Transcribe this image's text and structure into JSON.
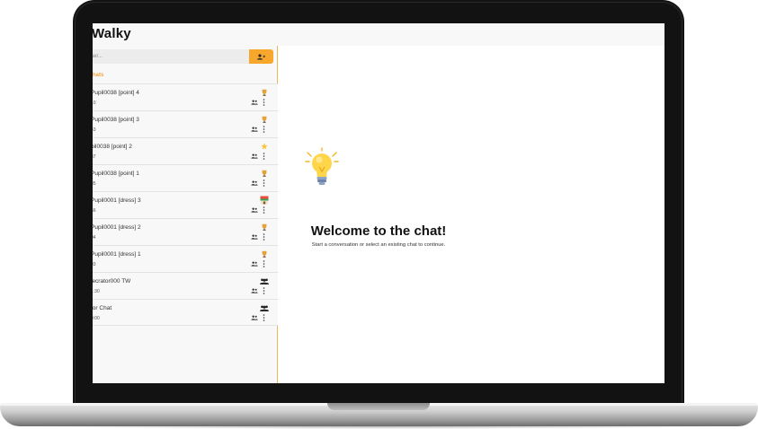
{
  "app": {
    "title": "Walky"
  },
  "search": {
    "placeholder": "ser..."
  },
  "sidebar": {
    "section_label": "hats",
    "chats": [
      {
        "name": "Pupil0038 [point] 4",
        "time": "10",
        "avatar": "trophy-icon"
      },
      {
        "name": "Pupil0038 [point] 3",
        "time": "43",
        "avatar": "trophy-icon"
      },
      {
        "name": "pil0038 [point] 2",
        "time": "37",
        "avatar": "star-icon"
      },
      {
        "name": "Pupil0038 [point] 1",
        "time": "35",
        "avatar": "trophy-icon"
      },
      {
        "name": "Pupil0001 [dress] 3",
        "time": "56",
        "avatar": "shop-icon"
      },
      {
        "name": "Pupil0001 [dress] 2",
        "time": "04",
        "avatar": "trophy-icon"
      },
      {
        "name": "Pupil0001 [dress] 1",
        "time": "03",
        "avatar": "trophy-icon"
      },
      {
        "name": "lecrator000 TW",
        "time": "1:30",
        "avatar": "group-icon"
      },
      {
        "name": "tor Chat",
        "time": "0:00",
        "avatar": "group-icon"
      }
    ]
  },
  "main": {
    "welcome_title": "Welcome to the chat!",
    "welcome_subtitle": "Start a conversation or select an existing chat to continue."
  },
  "colors": {
    "accent": "#f7a72c",
    "frame": "#121212"
  }
}
